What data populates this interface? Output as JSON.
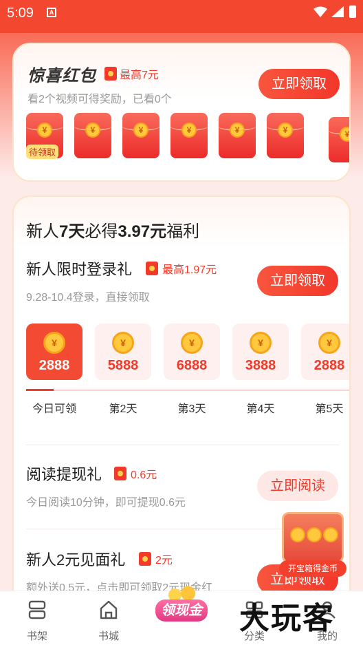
{
  "status_bar": {
    "time": "5:09",
    "notice_icon": "a-notification-icon"
  },
  "surprise": {
    "title": "惊喜红包",
    "max_label": "最高7元",
    "subtitle": "看2个视频可得奖励，已看0个",
    "button": "立即领取",
    "envelopes": [
      {
        "tag": "待领取"
      },
      {
        "tag": ""
      },
      {
        "tag": ""
      },
      {
        "tag": ""
      },
      {
        "tag": ""
      },
      {
        "tag": ""
      },
      {
        "tag": ""
      }
    ]
  },
  "welfare": {
    "title_prefix": "新人",
    "title_days": "7天",
    "title_mid": "必得",
    "title_amount": "3.97元",
    "title_suffix": "福利",
    "login": {
      "title": "新人限时登录礼",
      "max_label": "最高1.97元",
      "subtitle": "9.28-10.4登录，直接领取",
      "button": "立即领取"
    },
    "days": [
      {
        "value": "2888",
        "label": "今日可领",
        "active": true
      },
      {
        "value": "5888",
        "label": "第2天",
        "active": false
      },
      {
        "value": "6888",
        "label": "第3天",
        "active": false
      },
      {
        "value": "3888",
        "label": "第4天",
        "active": false
      },
      {
        "value": "2888",
        "label": "第5天",
        "active": false
      }
    ],
    "reading": {
      "title": "阅读提现礼",
      "amount": "0.6元",
      "subtitle": "今日阅读10分钟，即可提现0.6元",
      "button": "立即阅读"
    },
    "meet": {
      "title": "新人2元见面礼",
      "amount": "2元",
      "subtitle": "额外送0.5元，点击即可领取2元现金红",
      "button": "立即领取"
    }
  },
  "chest": {
    "label": "开宝箱得金币"
  },
  "tabbar": {
    "bookshelf": "书架",
    "bookstore": "书城",
    "center": "领现金",
    "category": "分类",
    "mine": "我的"
  },
  "watermark": "大玩客",
  "colors": {
    "accent": "#f23a2b",
    "status_bar": "#f4472f",
    "gold": "#ffc83d"
  }
}
